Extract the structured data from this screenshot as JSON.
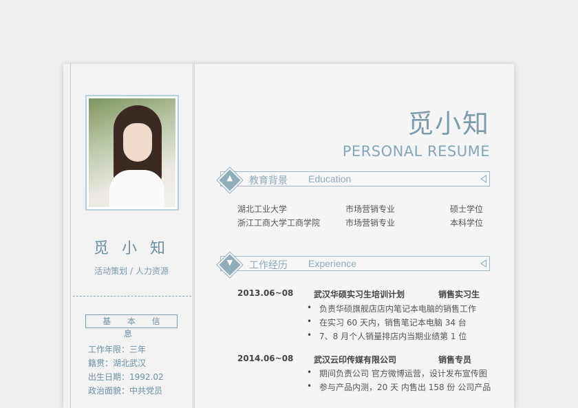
{
  "sidebar": {
    "name": "觅 小 知",
    "role": "活动策划 / 人力资源",
    "basic_info_title": "基 本 信 息",
    "info": [
      "工作年限：三年",
      "籍贯：湖北武汉",
      "出生日期：1992.02",
      "政治面貌：中共党员"
    ]
  },
  "header": {
    "name": "觅小知",
    "subtitle": "PERSONAL RESUME"
  },
  "education": {
    "title_cn": "教育背景",
    "title_en": "Education",
    "icon": "graduation-cap-icon",
    "rows": [
      {
        "school": "湖北工业大学",
        "major": "市场营销专业",
        "degree": "硕士学位"
      },
      {
        "school": "浙江工商大学工商学院",
        "major": "市场营销专业",
        "degree": "本科学位"
      }
    ]
  },
  "experience": {
    "title_cn": "工作经历",
    "title_en": "Experience",
    "icon": "tie-icon",
    "jobs": [
      {
        "date": "2013.06~08",
        "company": "武汉华硕实习生培训计划",
        "position": "销售实习生",
        "bullets": [
          "负责华硕旗舰店店内笔记本电脑的销售工作",
          "在实习 60 天内，销售笔记本电脑 34 台",
          "7、8 月个人销量排店内当期业绩第 1 位"
        ]
      },
      {
        "date": "2014.06~08",
        "company": "武汉云印传媒有限公司",
        "position": "销售专员",
        "bullets": [
          "期间负责公司  官方微博运营，设计发布宣传图",
          "参与产品内测，20 天  内售出  158 份  公司产品"
        ]
      }
    ]
  },
  "colors": {
    "accent": "#8ea9b7",
    "text": "#555555",
    "background": "#eeeeee"
  }
}
